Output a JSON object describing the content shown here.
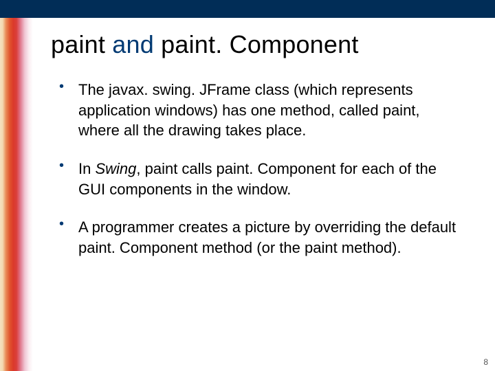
{
  "title": {
    "part1": "paint",
    "conj": " and ",
    "part2": "paint. Component"
  },
  "bullets": [
    {
      "pre": "The javax. swing. JFrame class (which represents application windows) has one method, called paint, where all the drawing takes place."
    },
    {
      "pre": "In ",
      "italic": "Swing",
      "post": ", paint calls paint. Component for each of the GUI components in the window."
    },
    {
      "pre": "A programmer creates a picture by overriding the default paint. Component method (or the paint method)."
    }
  ],
  "pageNumber": "8"
}
